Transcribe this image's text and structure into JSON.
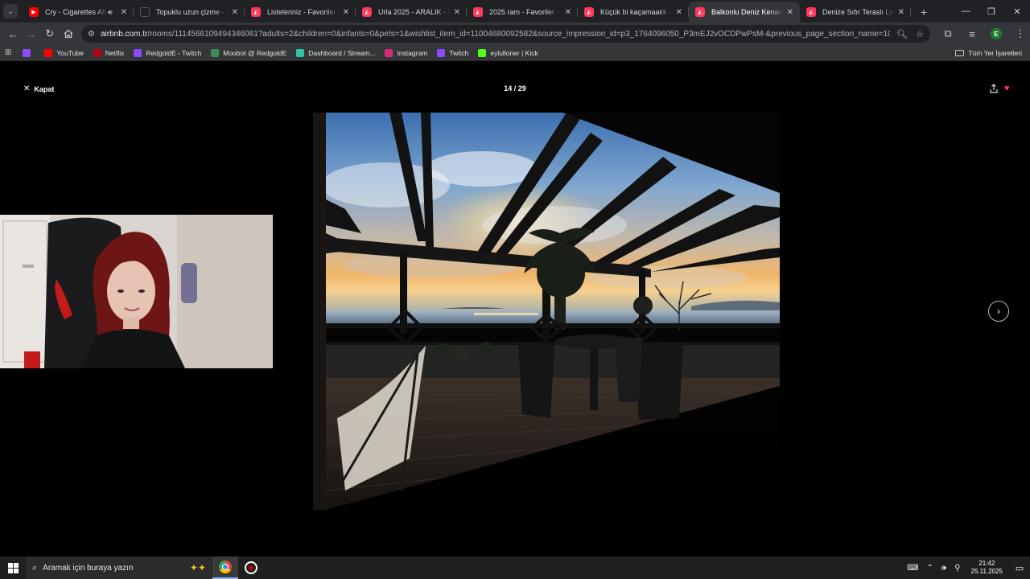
{
  "browser": {
    "tabs": [
      {
        "title": "Cry - Cigarettes After",
        "favicon": "youtube-icon",
        "audio": true,
        "active": false
      },
      {
        "title": "Topuklu uzun çizme - Kad",
        "favicon": "generic-icon",
        "audio": false,
        "active": false
      },
      {
        "title": "Listeleriniz - Favoriler - Air",
        "favicon": "airbnb-icon",
        "audio": false,
        "active": false
      },
      {
        "title": "Urla 2025 - ARALIK - Favo",
        "favicon": "airbnb-icon",
        "audio": false,
        "active": false
      },
      {
        "title": "2025 ram - Favoriler - Airb",
        "favicon": "airbnb-icon",
        "audio": false,
        "active": false
      },
      {
        "title": "Küçük bi kaçamaakk - Fav",
        "favicon": "airbnb-icon",
        "audio": false,
        "active": false
      },
      {
        "title": "Balkonlu Deniz Kenarı Dai",
        "favicon": "airbnb-icon",
        "audio": false,
        "active": true
      },
      {
        "title": "Denize Sıfır Teraslı Loft - A",
        "favicon": "airbnb-icon",
        "audio": false,
        "active": false
      }
    ],
    "new_tab_symbol": "+",
    "address": {
      "host": "airbnb.com.tr",
      "path": "/rooms/1114566109494346061?adults=2&children=0&infants=0&pets=1&wishlist_item_id=11004680092582&source_impression_id=p3_1764096050_P3mEJ2vOCDPwPsM-&previous_page_section_name=1000&modal=PH..."
    },
    "profile_initial": "E",
    "bookmarks": [
      {
        "label": "",
        "icon": "twitch-icon",
        "color": "#9146ff"
      },
      {
        "label": "YouTube",
        "icon": "youtube-icon",
        "color": "#ff0000"
      },
      {
        "label": "Netflix",
        "icon": "netflix-icon",
        "color": "#b20710"
      },
      {
        "label": "RedgoldE - Twitch",
        "icon": "twitch-icon",
        "color": "#9146ff"
      },
      {
        "label": "Moobot @ RedgoldE",
        "icon": "moobot-icon",
        "color": "#3c8c5a"
      },
      {
        "label": "Dashboard / Stream...",
        "icon": "streamlabs-icon",
        "color": "#31c3a2"
      },
      {
        "label": "Instagram",
        "icon": "instagram-icon",
        "color": "#d62976"
      },
      {
        "label": "Twitch",
        "icon": "twitch-icon",
        "color": "#9146ff"
      },
      {
        "label": "eylulloner | Kick",
        "icon": "kick-icon",
        "color": "#53fc18"
      }
    ],
    "all_bookmarks_label": "Tüm Yer İşaretleri"
  },
  "viewer": {
    "close_label": "Kapat",
    "counter": "14 / 29",
    "favorite": true,
    "next_symbol": "›"
  },
  "taskbar": {
    "search_placeholder": "Aramak için buraya yazın",
    "time": "21:42",
    "date": "25.11.2025"
  },
  "colors": {
    "airbnb_accent": "#ff385c",
    "chrome_frame": "#202124",
    "chrome_toolbar": "#35363a"
  }
}
